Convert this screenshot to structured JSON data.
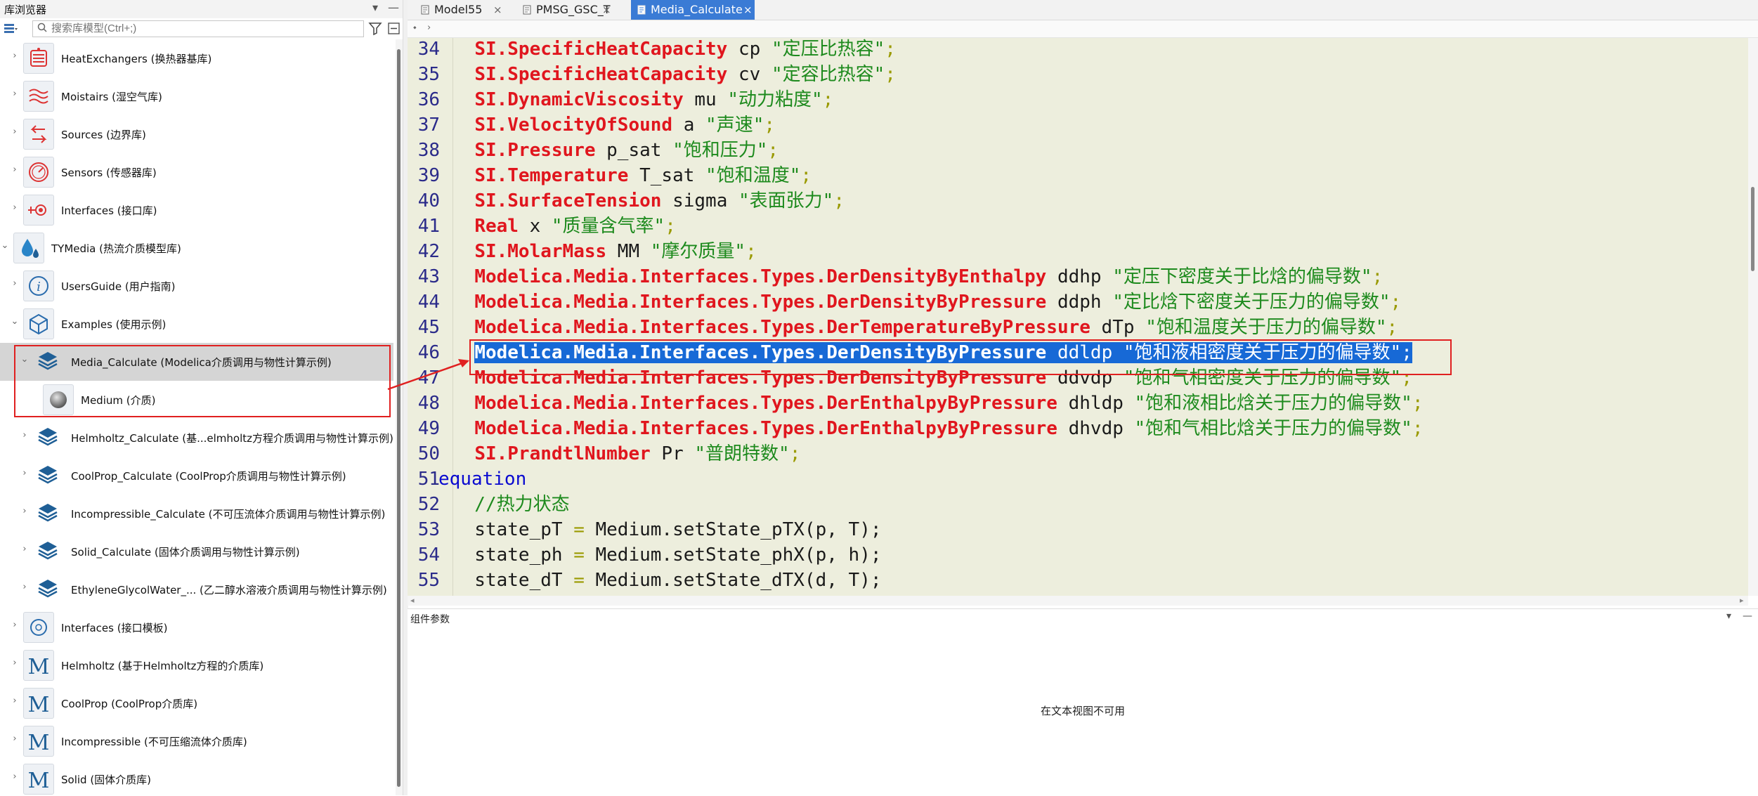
{
  "left_panel": {
    "title": "库浏览器",
    "controls": {
      "menu": "▾",
      "minimize": "—"
    },
    "search_placeholder": "搜索库模型(Ctrl+;)",
    "tree": [
      {
        "label": "HeatExchangers (换热器基库)",
        "icon": "heat-exchanger-icon"
      },
      {
        "label": "Moistairs (湿空气库)",
        "icon": "moist-air-icon"
      },
      {
        "label": "Sources (边界库)",
        "icon": "sources-arrows-icon"
      },
      {
        "label": "Sensors (传感器库)",
        "icon": "sensor-gauge-icon"
      },
      {
        "label": "Interfaces (接口库)",
        "icon": "interface-connector-icon"
      },
      {
        "label": "TYMedia (热流介质模型库)",
        "icon": "drops-icon"
      },
      {
        "label": "UsersGuide (用户指南)",
        "icon": "info-icon"
      },
      {
        "label": "Examples (使用示例)",
        "icon": "cube-icon"
      },
      {
        "label": "Media_Calculate (Modelica介质调用与物性计算示例)",
        "icon": "layers-icon"
      },
      {
        "label": "Medium (介质)",
        "icon": "sphere-icon"
      },
      {
        "label": "Helmholtz_Calculate (基...elmholtz方程介质调用与物性计算示例)",
        "icon": "layers-icon"
      },
      {
        "label": "CoolProp_Calculate (CoolProp介质调用与物性计算示例)",
        "icon": "layers-icon"
      },
      {
        "label": "Incompressible_Calculate (不可压流体介质调用与物性计算示例)",
        "icon": "layers-icon"
      },
      {
        "label": "Solid_Calculate (固体介质调用与物性计算示例)",
        "icon": "layers-icon"
      },
      {
        "label": "EthyleneGlycolWater_... (乙二醇水溶液介质调用与物性计算示例)",
        "icon": "layers-icon"
      },
      {
        "label": "Interfaces (接口模板)",
        "icon": "interface-template-icon"
      },
      {
        "label": "Helmholtz (基于Helmholtz方程的介质库)",
        "icon": "modelica-m-icon"
      },
      {
        "label": "CoolProp (CoolProp介质库)",
        "icon": "modelica-m-icon"
      },
      {
        "label": "Incompressible (不可压缩流体介质库)",
        "icon": "modelica-m-icon"
      },
      {
        "label": "Solid (固体介质库)",
        "icon": "modelica-m-icon"
      }
    ]
  },
  "tabs": [
    {
      "label": "Model55",
      "close": "×"
    },
    {
      "label": "PMSG_GSC_T",
      "close": "×"
    },
    {
      "label": "Media_Calculate",
      "close": "×",
      "active": true
    }
  ],
  "editor": {
    "lines": [
      {
        "n": "34",
        "type": "SI.SpecificHeatCapacity",
        "name": " cp ",
        "str": "\"定压比热容\"",
        "end": ";"
      },
      {
        "n": "35",
        "type": "SI.SpecificHeatCapacity",
        "name": " cv ",
        "str": "\"定容比热容\"",
        "end": ";"
      },
      {
        "n": "36",
        "type": "SI.DynamicViscosity",
        "name": " mu ",
        "str": "\"动力粘度\"",
        "end": ";"
      },
      {
        "n": "37",
        "type": "SI.VelocityOfSound",
        "name": " a ",
        "str": "\"声速\"",
        "end": ";"
      },
      {
        "n": "38",
        "type": "SI.Pressure",
        "name": " p_sat ",
        "str": "\"饱和压力\"",
        "end": ";"
      },
      {
        "n": "39",
        "type": "SI.Temperature",
        "name": " T_sat ",
        "str": "\"饱和温度\"",
        "end": ";"
      },
      {
        "n": "40",
        "type": "SI.SurfaceTension",
        "name": " sigma ",
        "str": "\"表面张力\"",
        "end": ";"
      },
      {
        "n": "41",
        "type": "Real",
        "name": " x ",
        "str": "\"质量含气率\"",
        "end": ";"
      },
      {
        "n": "42",
        "type": "SI.MolarMass",
        "name": " MM ",
        "str": "\"摩尔质量\"",
        "end": ";"
      },
      {
        "n": "43",
        "type": "Modelica.Media.Interfaces.Types.DerDensityByEnthalpy",
        "name": " ddhp ",
        "str": "\"定压下密度关于比焓的偏导数\"",
        "end": ";"
      },
      {
        "n": "44",
        "type": "Modelica.Media.Interfaces.Types.DerDensityByPressure",
        "name": " ddph ",
        "str": "\"定比焓下密度关于压力的偏导数\"",
        "end": ";"
      },
      {
        "n": "45",
        "type": "Modelica.Media.Interfaces.Types.DerTemperatureByPressure",
        "name": " dTp ",
        "str": "\"饱和温度关于压力的偏导数\"",
        "end": ";"
      },
      {
        "n": "46",
        "type": "Modelica.Media.Interfaces.Types.DerDensityByPressure",
        "name": " ddldp ",
        "str": "\"饱和液相密度关于压力的偏导数\"",
        "end": ";",
        "selected": true
      },
      {
        "n": "47",
        "type": "Modelica.Media.Interfaces.Types.DerDensityByPressure",
        "name": " ddvdp ",
        "str": "\"饱和气相密度关于压力的偏导数\"",
        "end": ";"
      },
      {
        "n": "48",
        "type": "Modelica.Media.Interfaces.Types.DerEnthalpyByPressure",
        "name": " dhldp ",
        "str": "\"饱和液相比焓关于压力的偏导数\"",
        "end": ";"
      },
      {
        "n": "49",
        "type": "Modelica.Media.Interfaces.Types.DerEnthalpyByPressure",
        "name": " dhvdp ",
        "str": "\"饱和气相比焓关于压力的偏导数\"",
        "end": ";"
      },
      {
        "n": "50",
        "type": "SI.PrandtlNumber",
        "name": " Pr ",
        "str": "\"普朗特数\"",
        "end": ";"
      }
    ],
    "equation_line": {
      "n": "51",
      "keyword": "equation"
    },
    "comment_line": {
      "n": "52",
      "text": "  //热力状态"
    },
    "stmt_lines": [
      {
        "n": "53",
        "lhs": "  state_pT ",
        "eq": "=",
        "fn": " Medium.setState_pTX",
        "args": "(p, T);"
      },
      {
        "n": "54",
        "lhs": "  state_ph ",
        "eq": "=",
        "fn": " Medium.setState_phX",
        "args": "(p, h);"
      },
      {
        "n": "55",
        "lhs": "  state_dT ",
        "eq": "=",
        "fn": " Medium.setState_dTX",
        "args": "(d, T);"
      }
    ]
  },
  "params_panel": {
    "title": "组件参数",
    "message": "在文本视图不可用",
    "controls": {
      "menu": "▾",
      "minimize": "—"
    }
  },
  "colors": {
    "editor_bg": "#edeedd",
    "type_red": "#e0161e",
    "string_green": "#1d8a1d",
    "keyword_blue": "#0a0ad0",
    "selection": "#1769d6",
    "tab_active": "#3a7bd5",
    "annotation_red": "#e02020"
  }
}
